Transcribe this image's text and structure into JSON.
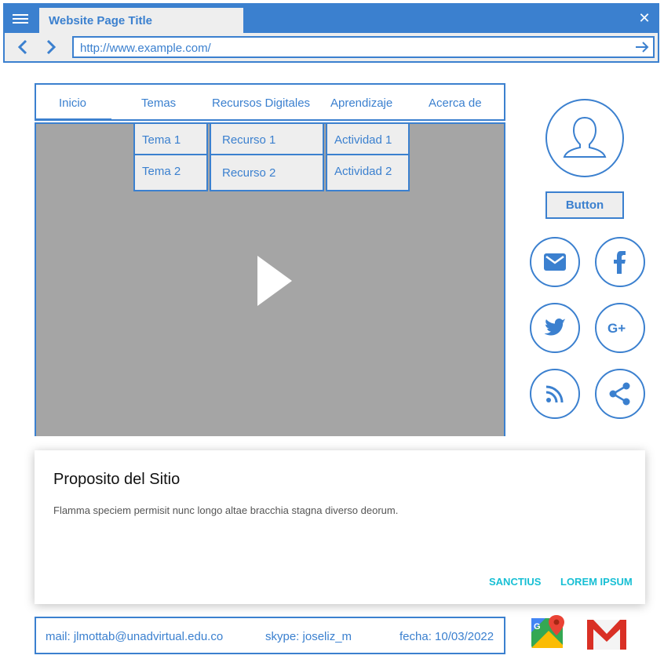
{
  "browser": {
    "tab_title": "Website Page Title",
    "url": "http://www.example.com/"
  },
  "nav": {
    "items": [
      "Inicio",
      "Temas",
      "Recursos Digitales",
      "Aprendizaje",
      "Acerca de"
    ],
    "active": "Inicio"
  },
  "dropdowns": {
    "temas": [
      "Tema 1",
      "Tema 2"
    ],
    "recursos": [
      "Recurso 1",
      "Recurso 2"
    ],
    "actividades": [
      "Actividad 1",
      "Actividad 2"
    ]
  },
  "sidebar": {
    "button_label": "Button",
    "social_icons": [
      "mail-icon",
      "facebook-icon",
      "twitter-icon",
      "google-plus-icon",
      "rss-icon",
      "share-icon"
    ]
  },
  "card": {
    "title": "Proposito del Sitio",
    "text": "Flamma speciem permisit nunc longo altae bracchia stagna diverso deorum.",
    "actions": [
      "SANCTIUS",
      "LOREM IPSUM"
    ]
  },
  "footer": {
    "mail": "mail: jlmottab@unadvirtual.edu.co",
    "skype": "skype: joseliz_m",
    "fecha": "fecha: 10/03/2022"
  },
  "colors": {
    "accent": "#3b80cf",
    "action": "#17bfd4",
    "video_bg": "#a5a5a5",
    "panel_bg": "#eeeeee"
  }
}
